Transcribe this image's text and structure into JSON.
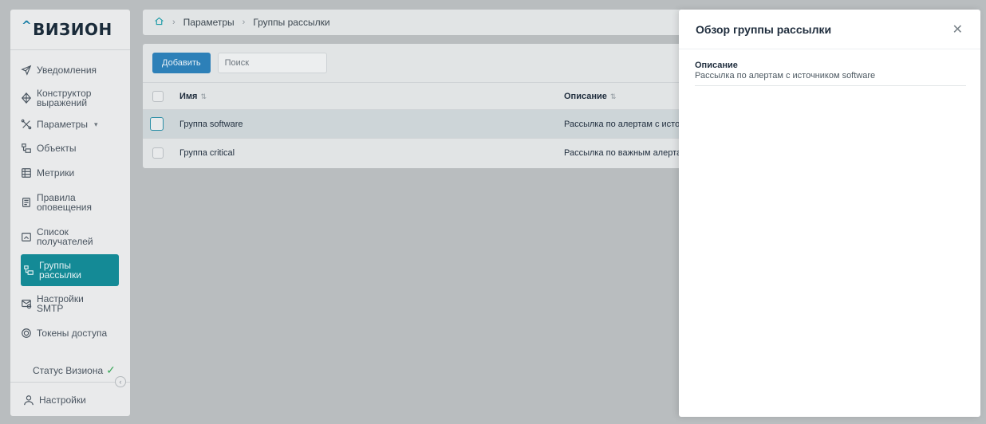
{
  "app": {
    "logo": "ВИЗИОН",
    "logo_caret": "^"
  },
  "sidebar": {
    "items": [
      {
        "label": "Уведомления",
        "icon": "send-icon"
      },
      {
        "label": "Конструктор выражений",
        "line1": "Конструктор",
        "line2": "выражений",
        "icon": "constructor-icon"
      },
      {
        "label": "Параметры",
        "icon": "tools-icon",
        "chevron": "▾"
      },
      {
        "label": "Объекты",
        "icon": "objects-icon"
      },
      {
        "label": "Метрики",
        "icon": "metrics-icon"
      },
      {
        "label": "Правила оповещения",
        "line1": "Правила",
        "line2": "оповещения",
        "icon": "rules-icon"
      },
      {
        "label": "Список получателей",
        "line1": "Список",
        "line2": "получателей",
        "icon": "recipients-icon"
      },
      {
        "label": "Группы рассылки",
        "line1": "Группы",
        "line2": "рассылки",
        "icon": "groups-icon",
        "active": true
      },
      {
        "label": "Настройки SMTP",
        "line1": "Настройки",
        "line2": "SMTP",
        "icon": "smtp-icon"
      },
      {
        "label": "Токены доступа",
        "icon": "token-icon"
      }
    ],
    "status_label": "Статус Визиона",
    "settings_label": "Настройки"
  },
  "breadcrumb": {
    "items": [
      "Параметры",
      "Группы рассылки"
    ]
  },
  "toolbar": {
    "add_label": "Добавить",
    "search_placeholder": "Поиск"
  },
  "table": {
    "columns": [
      "Имя",
      "Описание"
    ],
    "rows": [
      {
        "name": "Группа software",
        "description": "Рассылка по алертам с исто"
      },
      {
        "name": "Группа critical",
        "description": "Рассылка по важным алерта"
      }
    ]
  },
  "drawer": {
    "title": "Обзор группы рассылки",
    "field_label": "Описание",
    "field_value": "Рассылка по алертам с источником software"
  },
  "colors": {
    "accent": "#148a96",
    "primary_button": "#2d80b8",
    "status_ok": "#3aa85a"
  }
}
